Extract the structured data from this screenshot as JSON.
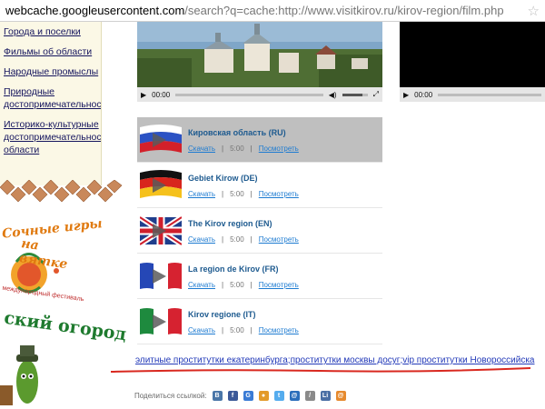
{
  "address_bar": {
    "domain": "webcache.googleusercontent.com",
    "path": "/search?q=cache:http://www.visitkirov.ru/kirov-region/film.php",
    "star_icon": "star-icon"
  },
  "sidebar": {
    "items": [
      {
        "label": "Города и поселки"
      },
      {
        "label": "Фильмы об области"
      },
      {
        "label": "Народные промыслы"
      },
      {
        "label": "Природные достопримечательности"
      },
      {
        "label": "Историко-культурные достопримечательности области"
      }
    ]
  },
  "logos": {
    "festival_line1": "Сочные игры",
    "festival_line2": "на вятке",
    "festival_line3": "международный фестиваль",
    "ogorod_text": "ский огород"
  },
  "video_players": [
    {
      "time": "00:00",
      "icons": [
        "play-icon",
        "volume-icon",
        "fullscreen-icon"
      ]
    },
    {
      "time": "00:00",
      "icons": [
        "play-icon"
      ]
    }
  ],
  "films": [
    {
      "title": "Кировская область (RU)",
      "download": "Скачать",
      "duration": "5:00",
      "watch": "Посмотреть",
      "flag": "russia-flag-icon",
      "active": true
    },
    {
      "title": "Gebiet Kirow (DE)",
      "download": "Скачать",
      "duration": "5:00",
      "watch": "Посмотреть",
      "flag": "germany-flag-icon",
      "active": false
    },
    {
      "title": "The Kirov region (EN)",
      "download": "Скачать",
      "duration": "5:00",
      "watch": "Посмотреть",
      "flag": "uk-flag-icon",
      "active": false
    },
    {
      "title": "La region de Kirov (FR)",
      "download": "Скачать",
      "duration": "5:00",
      "watch": "Посмотреть",
      "flag": "france-flag-icon",
      "active": false
    },
    {
      "title": "Kirov regione (IT)",
      "download": "Скачать",
      "duration": "5:00",
      "watch": "Посмотреть",
      "flag": "italy-flag-icon",
      "active": false
    }
  ],
  "separator": "|",
  "spam_links": {
    "link1": "элитные проститутки екатеринбурга",
    "sep1": ";",
    "link2": "проститутки москвы досуг",
    "sep2": ";",
    "link3": "vip проститутки Новороссийска"
  },
  "share": {
    "label": "Поделиться ссылкой:",
    "icons": [
      {
        "name": "vkontakte-icon",
        "glyph": "B",
        "color": "#4a76a8"
      },
      {
        "name": "facebook-icon",
        "glyph": "f",
        "color": "#3b5998"
      },
      {
        "name": "google-icon",
        "glyph": "G",
        "color": "#3a7bd5"
      },
      {
        "name": "chat-icon",
        "glyph": "●",
        "color": "#e39a2a"
      },
      {
        "name": "twitter-icon",
        "glyph": "t",
        "color": "#55acee"
      },
      {
        "name": "mail-icon",
        "glyph": "@",
        "color": "#2a6ebb"
      },
      {
        "name": "pen-icon",
        "glyph": "/",
        "color": "#8a8a8a"
      },
      {
        "name": "livejournal-icon",
        "glyph": "Li",
        "color": "#4a6fa5"
      },
      {
        "name": "liveinternet-icon",
        "glyph": "@",
        "color": "#e68a2e"
      }
    ]
  },
  "colors": {
    "sidebar_bg": "#fbf8e6",
    "link_blue": "#1d7bd1",
    "title_blue": "#1d5a8f",
    "annotation_red": "#d9281f"
  }
}
